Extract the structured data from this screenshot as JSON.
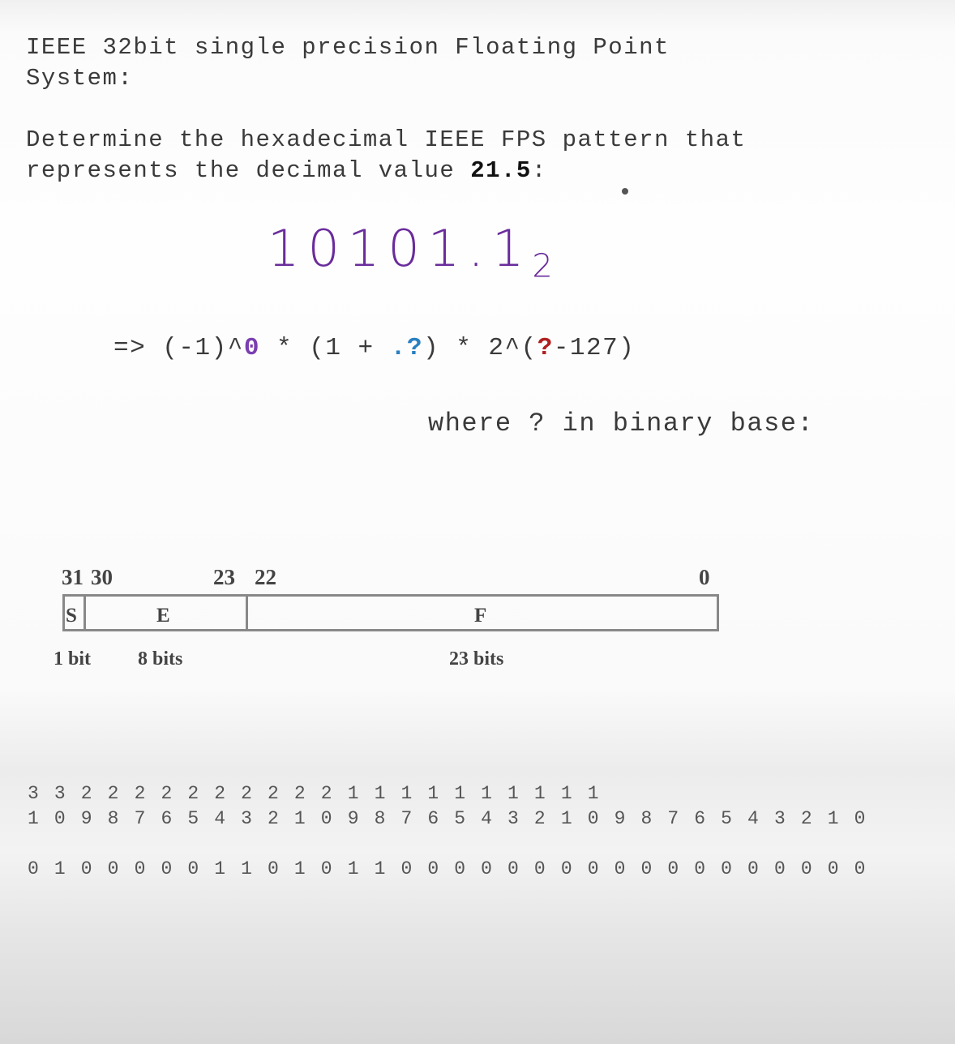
{
  "title": "IEEE 32bit single precision Floating Point\nSystem:",
  "question": {
    "prefix": "Determine the hexadecimal IEEE FPS pattern that\nrepresents the decimal value ",
    "value": "21.5",
    "suffix": ":"
  },
  "handwritten": {
    "number": "10101.1",
    "base": "2",
    "color": "#6a2c9c"
  },
  "formula": {
    "p1": "=> (-1)^",
    "sign": "0",
    "p2": " * (1 + ",
    "frac": ".?",
    "p3": ") * 2^(",
    "exp": "?",
    "p4": "-127)"
  },
  "formula_colors": {
    "sign": "#7a3fb0",
    "frac": "#2a7fc0",
    "exp": "#b02020"
  },
  "where_text": "where ? in binary base:",
  "diagram": {
    "bit_labels": {
      "b31": "31",
      "b30": "30",
      "b23": "23",
      "b22": "22",
      "b0": "0"
    },
    "fields": {
      "s": "S",
      "e": "E",
      "f": "F"
    },
    "sizes": {
      "s": "1 bit",
      "e": "8 bits",
      "f": "23 bits"
    }
  },
  "bit_index_tens": [
    "3",
    "3",
    "2",
    "2",
    "2",
    "2",
    "2",
    "2",
    "2",
    "2",
    "2",
    "2",
    "1",
    "1",
    "1",
    "1",
    "1",
    "1",
    "1",
    "1",
    "1",
    "1",
    "",
    "",
    "",
    "",
    "",
    "",
    "",
    "",
    "",
    ""
  ],
  "bit_index_ones": [
    "1",
    "0",
    "9",
    "8",
    "7",
    "6",
    "5",
    "4",
    "3",
    "2",
    "1",
    "0",
    "9",
    "8",
    "7",
    "6",
    "5",
    "4",
    "3",
    "2",
    "1",
    "0",
    "9",
    "8",
    "7",
    "6",
    "5",
    "4",
    "3",
    "2",
    "1",
    "0"
  ],
  "bit_values": [
    "0",
    "1",
    "0",
    "0",
    "0",
    "0",
    "0",
    "1",
    "1",
    "0",
    "1",
    "0",
    "1",
    "1",
    "0",
    "0",
    "0",
    "0",
    "0",
    "0",
    "0",
    "0",
    "0",
    "0",
    "0",
    "0",
    "0",
    "0",
    "0",
    "0",
    "0",
    "0"
  ]
}
